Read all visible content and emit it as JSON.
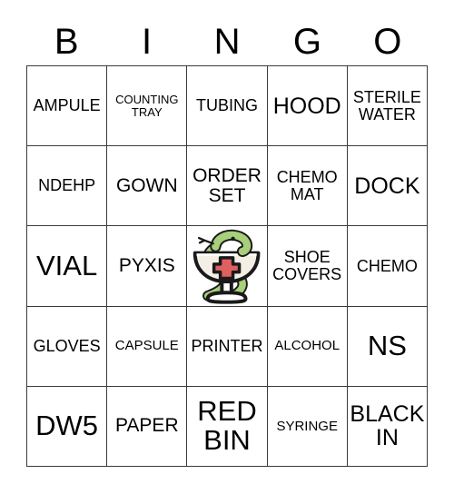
{
  "card": {
    "title": "BINGO",
    "header_letters": [
      "B",
      "I",
      "N",
      "G",
      "O"
    ],
    "grid_size": "5x5",
    "colors": {
      "grid_line": "#3a3a3a",
      "cell_background": "#ffffff",
      "text": "#000000",
      "snake_green": "#a8cf7a",
      "snake_outline": "#1a1a1a",
      "cross_red": "#e06060",
      "bowl_cream": "#f4efe6"
    },
    "rows": [
      [
        {
          "label": "AMPULE",
          "size": "md"
        },
        {
          "label": "COUNTING\nTRAY",
          "size": "xs"
        },
        {
          "label": "TUBING",
          "size": "md"
        },
        {
          "label": "HOOD",
          "size": "xl"
        },
        {
          "label": "STERILE\nWATER",
          "size": "md"
        }
      ],
      [
        {
          "label": "NDEHP",
          "size": "md"
        },
        {
          "label": "GOWN",
          "size": "lg"
        },
        {
          "label": "ORDER\nSET",
          "size": "lg"
        },
        {
          "label": "CHEMO\nMAT",
          "size": "md"
        },
        {
          "label": "DOCK",
          "size": "xl"
        }
      ],
      [
        {
          "label": "VIAL",
          "size": "xxl"
        },
        {
          "label": "PYXIS",
          "size": "lg"
        },
        {
          "label": "",
          "size": "md",
          "free_space": true,
          "icon": "bowl-of-hygieia-icon"
        },
        {
          "label": "SHOE\nCOVERS",
          "size": "md"
        },
        {
          "label": "CHEMO",
          "size": "md"
        }
      ],
      [
        {
          "label": "GLOVES",
          "size": "md"
        },
        {
          "label": "CAPSULE",
          "size": "sm"
        },
        {
          "label": "PRINTER",
          "size": "md"
        },
        {
          "label": "ALCOHOL",
          "size": "sm"
        },
        {
          "label": "NS",
          "size": "xxl"
        }
      ],
      [
        {
          "label": "DW5",
          "size": "xxl"
        },
        {
          "label": "PAPER",
          "size": "lg"
        },
        {
          "label": "RED\nBIN",
          "size": "xxl"
        },
        {
          "label": "SYRINGE",
          "size": "sm"
        },
        {
          "label": "BLACK\nIN",
          "size": "xl"
        }
      ]
    ]
  }
}
